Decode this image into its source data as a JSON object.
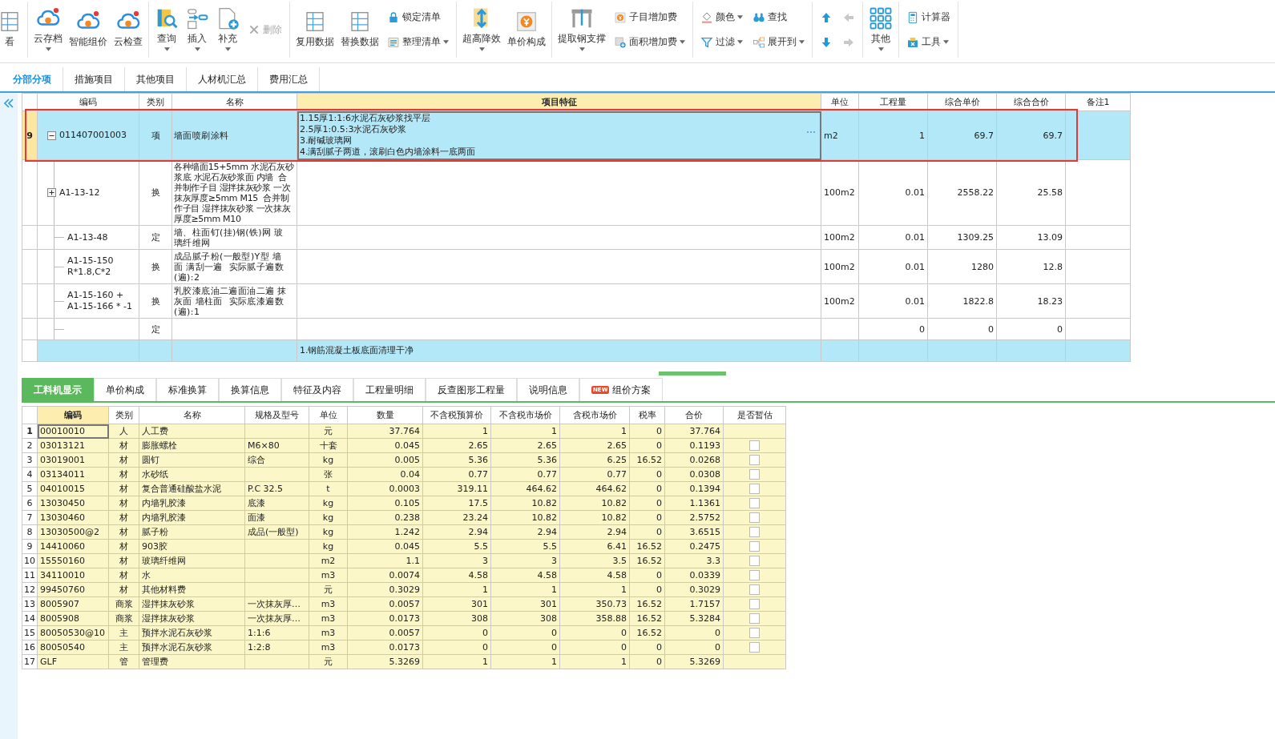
{
  "toolbar": [
    {
      "items": [
        {
          "kind": "big",
          "label": "看",
          "dropdown": false,
          "disabled": false
        }
      ]
    },
    {
      "items": [
        {
          "kind": "big",
          "label": "云存档",
          "dropdown": true,
          "disabled": false
        },
        {
          "kind": "big",
          "label": "智能组价",
          "dropdown": false,
          "disabled": false
        },
        {
          "kind": "big",
          "label": "云检查",
          "dropdown": false,
          "disabled": false
        }
      ]
    },
    {
      "items": [
        {
          "kind": "big",
          "label": "查询",
          "dropdown": true,
          "disabled": false
        },
        {
          "kind": "big",
          "label": "插入",
          "dropdown": true,
          "disabled": false
        },
        {
          "kind": "big",
          "label": "补充",
          "dropdown": true,
          "disabled": false
        },
        {
          "kind": "small",
          "label": "删除",
          "dropdown": false,
          "disabled": true
        }
      ]
    },
    {
      "items": [
        {
          "kind": "big",
          "label": "复用数据",
          "dropdown": false,
          "disabled": false
        },
        {
          "kind": "big",
          "label": "替换数据",
          "dropdown": false,
          "disabled": false
        },
        {
          "kind": "small",
          "label": "锁定清单",
          "dropdown": false,
          "disabled": false
        },
        {
          "kind": "small",
          "label": "整理清单",
          "dropdown": true,
          "disabled": false
        }
      ]
    },
    {
      "items": [
        {
          "kind": "big",
          "label": "超高降效",
          "dropdown": true,
          "disabled": false
        },
        {
          "kind": "big",
          "label": "单价构成",
          "dropdown": false,
          "disabled": false
        }
      ]
    },
    {
      "items": [
        {
          "kind": "big",
          "label": "提取钢支撑",
          "dropdown": true,
          "disabled": false
        },
        {
          "kind": "small",
          "label": "子目增加费",
          "dropdown": false,
          "disabled": false
        },
        {
          "kind": "small",
          "label": "面积增加费",
          "dropdown": true,
          "disabled": false
        }
      ]
    },
    {
      "items": [
        {
          "kind": "small",
          "label": "颜色",
          "dropdown": true,
          "disabled": false
        },
        {
          "kind": "small",
          "label": "过滤",
          "dropdown": true,
          "disabled": false
        },
        {
          "kind": "small",
          "label": "查找",
          "dropdown": false,
          "disabled": false
        },
        {
          "kind": "small",
          "label": "展开到",
          "dropdown": true,
          "disabled": false
        }
      ]
    },
    {
      "items": [
        {
          "kind": "arrow",
          "disabled": false
        },
        {
          "kind": "arrow",
          "disabled": false
        },
        {
          "kind": "arrow",
          "disabled": true
        },
        {
          "kind": "arrow",
          "disabled": true
        }
      ]
    },
    {
      "items": [
        {
          "kind": "big",
          "label": "其他",
          "dropdown": true,
          "disabled": false
        }
      ]
    },
    {
      "items": [
        {
          "kind": "small",
          "label": "计算器",
          "dropdown": false,
          "disabled": false
        },
        {
          "kind": "small",
          "label": "工具",
          "dropdown": true,
          "disabled": false
        }
      ]
    }
  ],
  "tabs": [
    {
      "label": "分部分项",
      "selected": true
    },
    {
      "label": "措施项目",
      "selected": false
    },
    {
      "label": "其他项目",
      "selected": false
    },
    {
      "label": "人材机汇总",
      "selected": false
    },
    {
      "label": "费用汇总",
      "selected": false
    }
  ],
  "bill_table": {
    "columns": [
      {
        "label": "编码",
        "selected": false
      },
      {
        "label": "类别",
        "selected": false
      },
      {
        "label": "名称",
        "selected": false
      },
      {
        "label": "项目特征",
        "selected": true
      },
      {
        "label": "单位",
        "selected": false
      },
      {
        "label": "工程量",
        "selected": false
      },
      {
        "label": "综合单价",
        "selected": false
      },
      {
        "label": "综合合价",
        "selected": false
      },
      {
        "label": "备注1",
        "selected": false
      }
    ],
    "rows": [
      {
        "num": "9",
        "kind": "bill",
        "selected": true,
        "expanded": true,
        "code": "011407001003",
        "category": "项",
        "name": "墙面喷刷涂料",
        "features": [
          "1.15厚1:1:6水泥石灰砂浆找平层",
          "2.5厚1:0.5:3水泥石灰砂浆",
          "3.耐碱玻璃网",
          "4.满刮腻子两道，滚刷白色内墙涂料一底两面"
        ],
        "unit": "m2",
        "quantity": "1",
        "unit_price": "69.7",
        "total": "69.7"
      },
      {
        "kind": "quota",
        "selected": false,
        "expanded": false,
        "code": "A1-13-12",
        "category": "换",
        "name": "各种墙面15+5mm 水泥石灰砂浆底 水泥石灰砂浆面 内墙  合并制作子目 湿拌抹灰砂浆 一次抹灰厚度≥5mm M15  合并制作子目 湿拌抹灰砂浆 一次抹灰厚度≥5mm M10",
        "unit": "100m2",
        "quantity": "0.01",
        "unit_price": "2558.22",
        "total": "25.58"
      },
      {
        "kind": "quota",
        "selected": false,
        "code": "A1-13-48",
        "category": "定",
        "name": "墙、柱面钉(挂)钢(铁)网 玻璃纤维网",
        "unit": "100m2",
        "quantity": "0.01",
        "unit_price": "1309.25",
        "total": "13.09"
      },
      {
        "kind": "quota",
        "selected": false,
        "code": "A1-15-150 R*1.8,C*2",
        "category": "换",
        "name": "成品腻子粉(一般型)Y型 墙面 满刮一遍  实际腻子遍数(遍):2",
        "unit": "100m2",
        "quantity": "0.01",
        "unit_price": "1280",
        "total": "12.8"
      },
      {
        "kind": "quota",
        "selected": false,
        "code": "A1-15-160 + A1-15-166 * -1",
        "category": "换",
        "name": "乳胶漆底油二遍面油二遍 抹灰面 墙柱面  实际底漆遍数(遍):1",
        "unit": "100m2",
        "quantity": "0.01",
        "unit_price": "1822.8",
        "total": "18.23"
      },
      {
        "kind": "quota",
        "selected": false,
        "category": "定",
        "quantity": "0",
        "unit_price": "0",
        "total": "0"
      },
      {
        "kind": "bill",
        "selected": false,
        "features": [
          "1.钢筋混凝土板底面清理干净"
        ]
      }
    ]
  },
  "detail_tabs": [
    {
      "label": "工料机显示",
      "selected": true
    },
    {
      "label": "单价构成",
      "selected": false
    },
    {
      "label": "标准换算",
      "selected": false
    },
    {
      "label": "换算信息",
      "selected": false
    },
    {
      "label": "特征及内容",
      "selected": false
    },
    {
      "label": "工程量明细",
      "selected": false
    },
    {
      "label": "反查图形工程量",
      "selected": false
    },
    {
      "label": "说明信息",
      "selected": false
    },
    {
      "label": "组价方案",
      "selected": false,
      "badge": "NEW"
    }
  ],
  "resource_table": {
    "columns": [
      {
        "label": "编码",
        "selected": true
      },
      {
        "label": "类别",
        "selected": false
      },
      {
        "label": "名称",
        "selected": false
      },
      {
        "label": "规格及型号",
        "selected": false
      },
      {
        "label": "单位",
        "selected": false
      },
      {
        "label": "数量",
        "selected": false
      },
      {
        "label": "不含税预算价",
        "selected": false
      },
      {
        "label": "不含税市场价",
        "selected": false
      },
      {
        "label": "含税市场价",
        "selected": false
      },
      {
        "label": "税率",
        "selected": false
      },
      {
        "label": "合价",
        "selected": false
      },
      {
        "label": "是否暂估",
        "selected": false
      }
    ],
    "rows": [
      {
        "no": "1",
        "selected": true,
        "code": "00010010",
        "category": "人",
        "name": "人工费",
        "unit": "元",
        "quantity": "37.764",
        "budget_price": "1",
        "market_price": "1",
        "tax_market_price": "1",
        "tax_rate": "0",
        "total": "37.764"
      },
      {
        "no": "2",
        "selected": false,
        "code": "03013121",
        "category": "材",
        "name": "膨胀螺栓",
        "spec": "M6×80",
        "unit": "十套",
        "quantity": "0.045",
        "budget_price": "2.65",
        "market_price": "2.65",
        "tax_market_price": "2.65",
        "tax_rate": "0",
        "total": "0.1193",
        "provisional": false
      },
      {
        "no": "3",
        "selected": false,
        "code": "03019001",
        "category": "材",
        "name": "圆钉",
        "spec": "综合",
        "unit": "kg",
        "quantity": "0.005",
        "budget_price": "5.36",
        "market_price": "5.36",
        "tax_market_price": "6.25",
        "tax_rate": "16.52",
        "total": "0.0268",
        "provisional": false
      },
      {
        "no": "4",
        "selected": false,
        "code": "03134011",
        "category": "材",
        "name": "水砂纸",
        "unit": "张",
        "quantity": "0.04",
        "budget_price": "0.77",
        "market_price": "0.77",
        "tax_market_price": "0.77",
        "tax_rate": "0",
        "total": "0.0308",
        "provisional": false
      },
      {
        "no": "5",
        "selected": false,
        "code": "04010015",
        "category": "材",
        "name": "复合普通硅酸盐水泥",
        "spec": "P.C 32.5",
        "unit": "t",
        "quantity": "0.0003",
        "budget_price": "319.11",
        "market_price": "464.62",
        "tax_market_price": "464.62",
        "tax_rate": "0",
        "total": "0.1394",
        "provisional": false
      },
      {
        "no": "6",
        "selected": false,
        "code": "13030450",
        "category": "材",
        "name": "内墙乳胶漆",
        "spec": "底漆",
        "unit": "kg",
        "quantity": "0.105",
        "budget_price": "17.5",
        "market_price": "10.82",
        "tax_market_price": "10.82",
        "tax_rate": "0",
        "total": "1.1361",
        "provisional": false
      },
      {
        "no": "7",
        "selected": false,
        "code": "13030460",
        "category": "材",
        "name": "内墙乳胶漆",
        "spec": "面漆",
        "unit": "kg",
        "quantity": "0.238",
        "budget_price": "23.24",
        "market_price": "10.82",
        "tax_market_price": "10.82",
        "tax_rate": "0",
        "total": "2.5752",
        "provisional": false
      },
      {
        "no": "8",
        "selected": false,
        "code": "13030500@2",
        "category": "材",
        "name": "腻子粉",
        "spec": "成品(一般型)",
        "unit": "kg",
        "quantity": "1.242",
        "budget_price": "2.94",
        "market_price": "2.94",
        "tax_market_price": "2.94",
        "tax_rate": "0",
        "total": "3.6515",
        "provisional": false
      },
      {
        "no": "9",
        "selected": false,
        "code": "14410060",
        "category": "材",
        "name": "903胶",
        "unit": "kg",
        "quantity": "0.045",
        "budget_price": "5.5",
        "market_price": "5.5",
        "tax_market_price": "6.41",
        "tax_rate": "16.52",
        "total": "0.2475",
        "provisional": false
      },
      {
        "no": "10",
        "selected": false,
        "code": "15550160",
        "category": "材",
        "name": "玻璃纤维网",
        "unit": "m2",
        "quantity": "1.1",
        "budget_price": "3",
        "market_price": "3",
        "tax_market_price": "3.5",
        "tax_rate": "16.52",
        "total": "3.3",
        "provisional": false
      },
      {
        "no": "11",
        "selected": false,
        "code": "34110010",
        "category": "材",
        "name": "水",
        "unit": "m3",
        "quantity": "0.0074",
        "budget_price": "4.58",
        "market_price": "4.58",
        "tax_market_price": "4.58",
        "tax_rate": "0",
        "total": "0.0339",
        "provisional": false
      },
      {
        "no": "12",
        "selected": false,
        "code": "99450760",
        "category": "材",
        "name": "其他材料费",
        "unit": "元",
        "quantity": "0.3029",
        "budget_price": "1",
        "market_price": "1",
        "tax_market_price": "1",
        "tax_rate": "0",
        "total": "0.3029",
        "provisional": false
      },
      {
        "no": "13",
        "selected": false,
        "code": "8005907",
        "category": "商浆",
        "name": "湿拌抹灰砂浆",
        "spec": "一次抹灰厚…",
        "unit": "m3",
        "quantity": "0.0057",
        "budget_price": "301",
        "market_price": "301",
        "tax_market_price": "350.73",
        "tax_rate": "16.52",
        "total": "1.7157",
        "provisional": false
      },
      {
        "no": "14",
        "selected": false,
        "code": "8005908",
        "category": "商浆",
        "name": "湿拌抹灰砂浆",
        "spec": "一次抹灰厚…",
        "unit": "m3",
        "quantity": "0.0173",
        "budget_price": "308",
        "market_price": "308",
        "tax_market_price": "358.88",
        "tax_rate": "16.52",
        "total": "5.3284",
        "provisional": false
      },
      {
        "no": "15",
        "selected": false,
        "code": "80050530@10",
        "category": "主",
        "name": "预拌水泥石灰砂浆",
        "spec": "1:1:6",
        "unit": "m3",
        "quantity": "0.0057",
        "budget_price": "0",
        "market_price": "0",
        "tax_market_price": "0",
        "tax_rate": "16.52",
        "total": "0",
        "provisional": false
      },
      {
        "no": "16",
        "selected": false,
        "code": "80050540",
        "category": "主",
        "name": "预拌水泥石灰砂浆",
        "spec": "1:2:8",
        "unit": "m3",
        "quantity": "0.0173",
        "budget_price": "0",
        "market_price": "0",
        "tax_market_price": "0",
        "tax_rate": "0",
        "total": "0",
        "provisional": false
      },
      {
        "no": "17",
        "selected": false,
        "code": "GLF",
        "category": "管",
        "name": "管理费",
        "unit": "元",
        "quantity": "5.3269",
        "budget_price": "1",
        "market_price": "1",
        "tax_market_price": "1",
        "tax_rate": "0",
        "total": "5.3269"
      }
    ]
  }
}
